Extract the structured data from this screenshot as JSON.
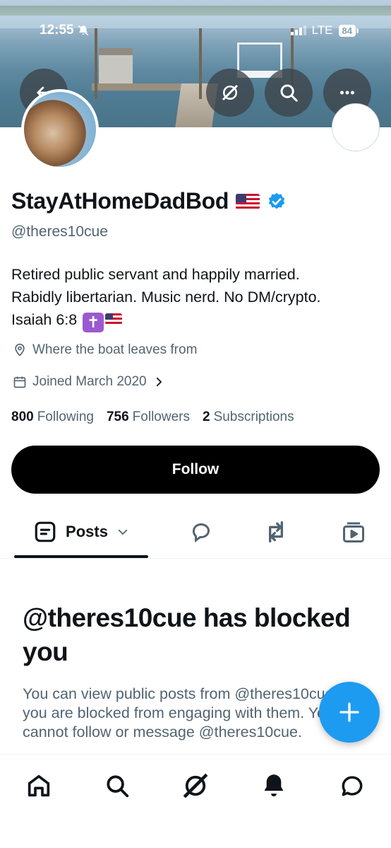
{
  "status_bar": {
    "time": "12:55",
    "network": "LTE",
    "battery": "84"
  },
  "profile": {
    "display_name": "StayAtHomeDadBod",
    "handle": "@theres10cue",
    "bio_line1": "Retired public servant and happily married.",
    "bio_line2": "Rabidly libertarian. Music nerd. No DM/crypto.",
    "bio_line3": "Isaiah 6:8",
    "location": "Where the boat leaves from",
    "joined": "Joined March 2020",
    "following_count": "800",
    "following_label": "Following",
    "followers_count": "756",
    "followers_label": "Followers",
    "subscriptions_count": "2",
    "subscriptions_label": "Subscriptions"
  },
  "follow_button": {
    "label": "Follow"
  },
  "tabs": {
    "posts_label": "Posts"
  },
  "blocked": {
    "title": "@theres10cue has blocked you",
    "body": "You can view public posts from @theres10cue, but you are blocked from engaging with them. You also cannot follow or message @theres10cue."
  },
  "colors": {
    "accent": "#1d9bf0",
    "text": "#0f1419",
    "secondary": "#536471"
  },
  "icons": [
    "back-arrow-icon",
    "grok-icon",
    "search-icon",
    "more-icon",
    "verified-badge-icon",
    "location-icon",
    "calendar-icon",
    "chevron-right-icon",
    "posts-icon",
    "chevron-down-icon",
    "reply-icon",
    "repost-icon",
    "media-icon",
    "plus-icon",
    "home-icon",
    "bell-icon",
    "messages-icon"
  ]
}
